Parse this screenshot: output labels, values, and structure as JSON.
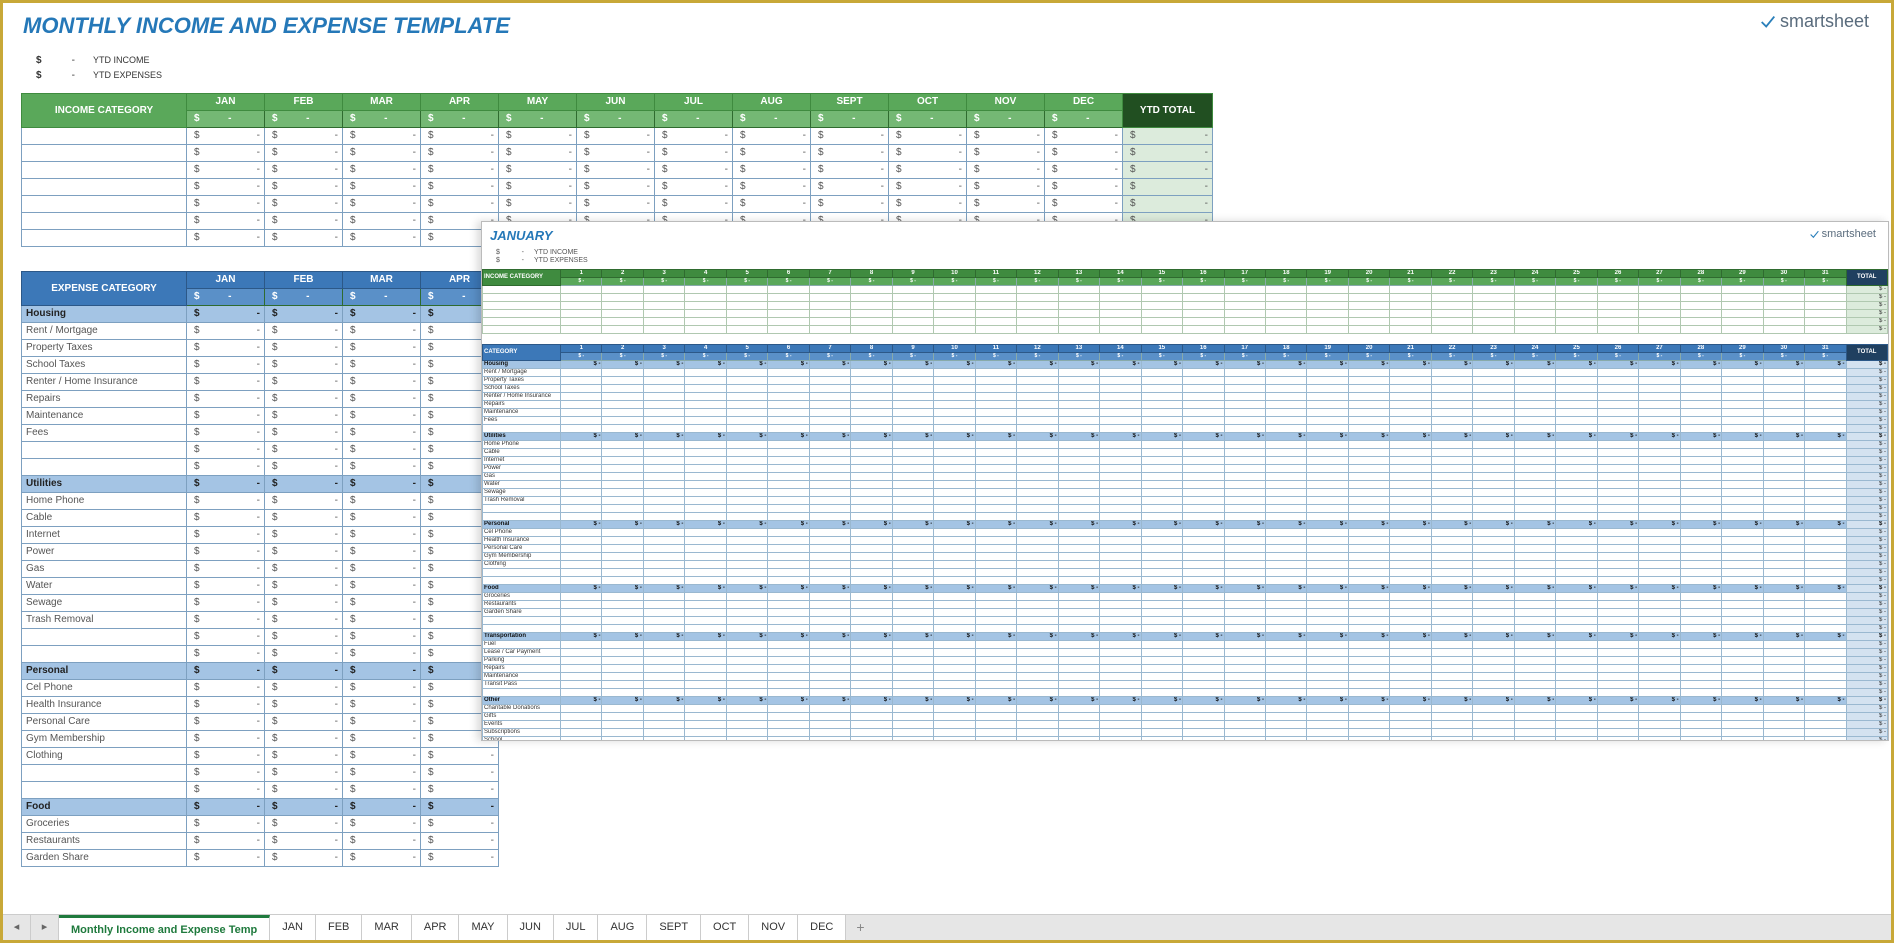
{
  "title": "MONTHLY INCOME AND EXPENSE TEMPLATE",
  "brand": "smartsheet",
  "summary": {
    "ytd_income_label": "YTD INCOME",
    "ytd_expenses_label": "YTD EXPENSES",
    "currency": "$",
    "dash": "-"
  },
  "months": [
    "JAN",
    "FEB",
    "MAR",
    "APR",
    "MAY",
    "JUN",
    "JUL",
    "AUG",
    "SEPT",
    "OCT",
    "NOV",
    "DEC"
  ],
  "ytd_label": "YTD TOTAL",
  "income_cat_label": "INCOME CATEGORY",
  "expense_cat_label": "EXPENSE CATEGORY",
  "income_blank_rows": 7,
  "expense_groups": [
    {
      "name": "Housing",
      "items": [
        "Rent / Mortgage",
        "Property Taxes",
        "School Taxes",
        "Renter / Home Insurance",
        "Repairs",
        "Maintenance",
        "Fees",
        "",
        ""
      ]
    },
    {
      "name": "Utilities",
      "items": [
        "Home Phone",
        "Cable",
        "Internet",
        "Power",
        "Gas",
        "Water",
        "Sewage",
        "Trash Removal",
        "",
        ""
      ]
    },
    {
      "name": "Personal",
      "items": [
        "Cel Phone",
        "Health Insurance",
        "Personal Care",
        "Gym Membership",
        "Clothing",
        "",
        ""
      ]
    },
    {
      "name": "Food",
      "items": [
        "Groceries",
        "Restaurants",
        "Garden Share"
      ]
    }
  ],
  "overlay": {
    "title": "JANUARY",
    "total_label": "TOTAL",
    "category_label": "CATEGORY",
    "summary1": "YTD INCOME",
    "summary2": "YTD EXPENSES",
    "days": [
      "1",
      "2",
      "3",
      "4",
      "5",
      "6",
      "7",
      "8",
      "9",
      "10",
      "11",
      "12",
      "13",
      "14",
      "15",
      "16",
      "17",
      "18",
      "19",
      "20",
      "21",
      "22",
      "23",
      "24",
      "25",
      "26",
      "27",
      "28",
      "29",
      "30",
      "31"
    ],
    "income_rows": 6,
    "expense_groups": [
      {
        "name": "Housing",
        "items": [
          "Rent / Mortgage",
          "Property Taxes",
          "School Taxes",
          "Renter / Home Insurance",
          "Repairs",
          "Maintenance",
          "Fees",
          ""
        ]
      },
      {
        "name": "Utilities",
        "items": [
          "Home Phone",
          "Cable",
          "Internet",
          "Power",
          "Gas",
          "Water",
          "Sewage",
          "Trash Removal",
          "",
          ""
        ]
      },
      {
        "name": "Personal",
        "items": [
          "Cel Phone",
          "Health Insurance",
          "Personal Care",
          "Gym Membership",
          "Clothing",
          "",
          ""
        ]
      },
      {
        "name": "Food",
        "items": [
          "Groceries",
          "Restaurants",
          "Garden Share",
          "",
          ""
        ]
      },
      {
        "name": "Transportation",
        "items": [
          "Fuel",
          "Lease / Car Payment",
          "Parking",
          "Repairs",
          "Maintenance",
          "Transit Pass",
          ""
        ]
      },
      {
        "name": "Other",
        "items": [
          "Charitable Donations",
          "Gifts",
          "Events",
          "Subscriptions",
          "School"
        ]
      }
    ]
  },
  "tabs": {
    "main": "Monthly Income and Expense Temp",
    "list": [
      "JAN",
      "FEB",
      "MAR",
      "APR",
      "MAY",
      "JUN",
      "JUL",
      "AUG",
      "SEPT",
      "OCT",
      "NOV",
      "DEC"
    ],
    "plus": "+"
  }
}
